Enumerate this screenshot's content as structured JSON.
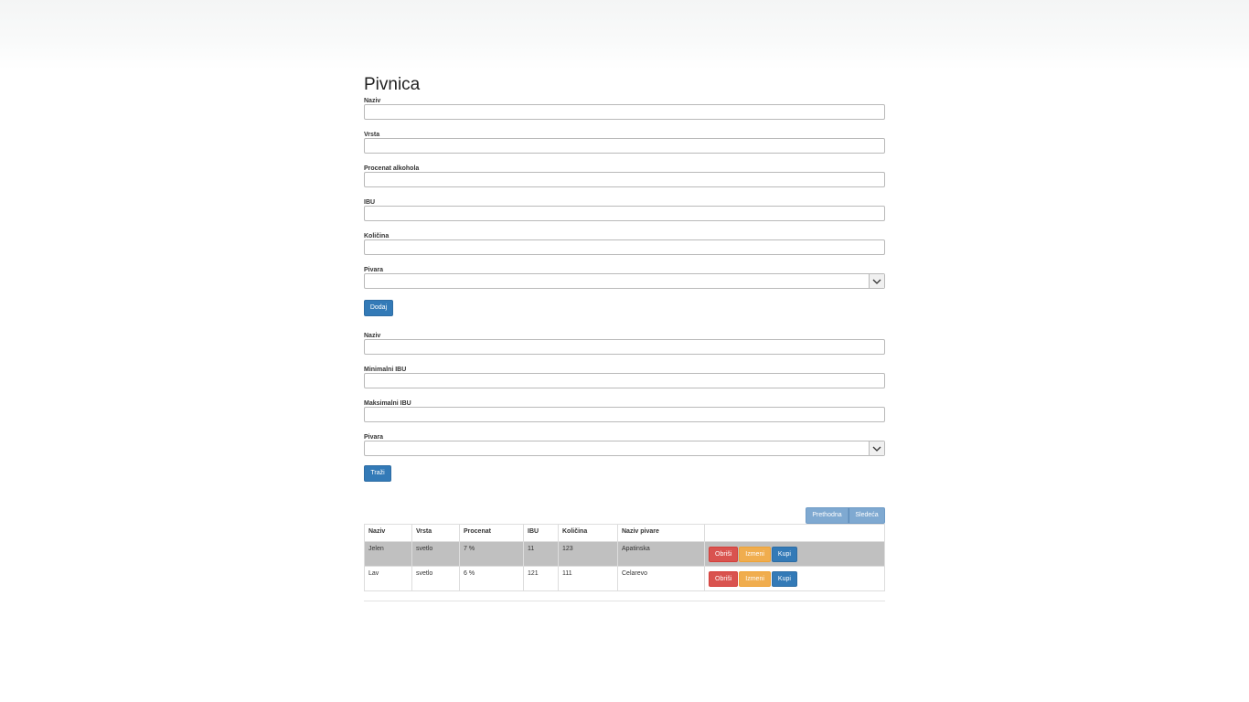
{
  "page": {
    "title": "Pivnica"
  },
  "add_form": {
    "fields": [
      {
        "label": "Naziv",
        "value": ""
      },
      {
        "label": "Vrsta",
        "value": ""
      },
      {
        "label": "Procenat alkohola",
        "value": ""
      },
      {
        "label": "IBU",
        "value": ""
      },
      {
        "label": "Količina",
        "value": ""
      }
    ],
    "brewery_label": "Pivara",
    "brewery_value": "",
    "submit_label": "Dodaj"
  },
  "search_form": {
    "fields": [
      {
        "label": "Naziv",
        "value": ""
      },
      {
        "label": "Minimalni IBU",
        "value": ""
      },
      {
        "label": "Maksimalni IBU",
        "value": ""
      }
    ],
    "brewery_label": "Pivara",
    "brewery_value": "",
    "submit_label": "Traži"
  },
  "pager": {
    "prev_label": "Prethodna",
    "next_label": "Sledeća"
  },
  "table": {
    "headers": [
      "Naziv",
      "Vrsta",
      "Procenat",
      "IBU",
      "Količina",
      "Naziv pivare",
      ""
    ],
    "rows": [
      {
        "naziv": "Jelen",
        "vrsta": "svetlo",
        "procenat": "7 %",
        "ibu": "11",
        "kolicina": "123",
        "pivara": "Apatinska"
      },
      {
        "naziv": "Lav",
        "vrsta": "svetlo",
        "procenat": "6 %",
        "ibu": "121",
        "kolicina": "111",
        "pivara": "Celarevo"
      }
    ],
    "actions": {
      "delete_label": "Obriši",
      "edit_label": "Izmeni",
      "buy_label": "Kupi"
    }
  },
  "colors": {
    "primary": "#337ab7",
    "danger": "#d9534f",
    "warning": "#f0ad4e",
    "highlight_row": "#c0c0c0"
  },
  "icons": {
    "select_arrow": "chevron-down-icon"
  }
}
